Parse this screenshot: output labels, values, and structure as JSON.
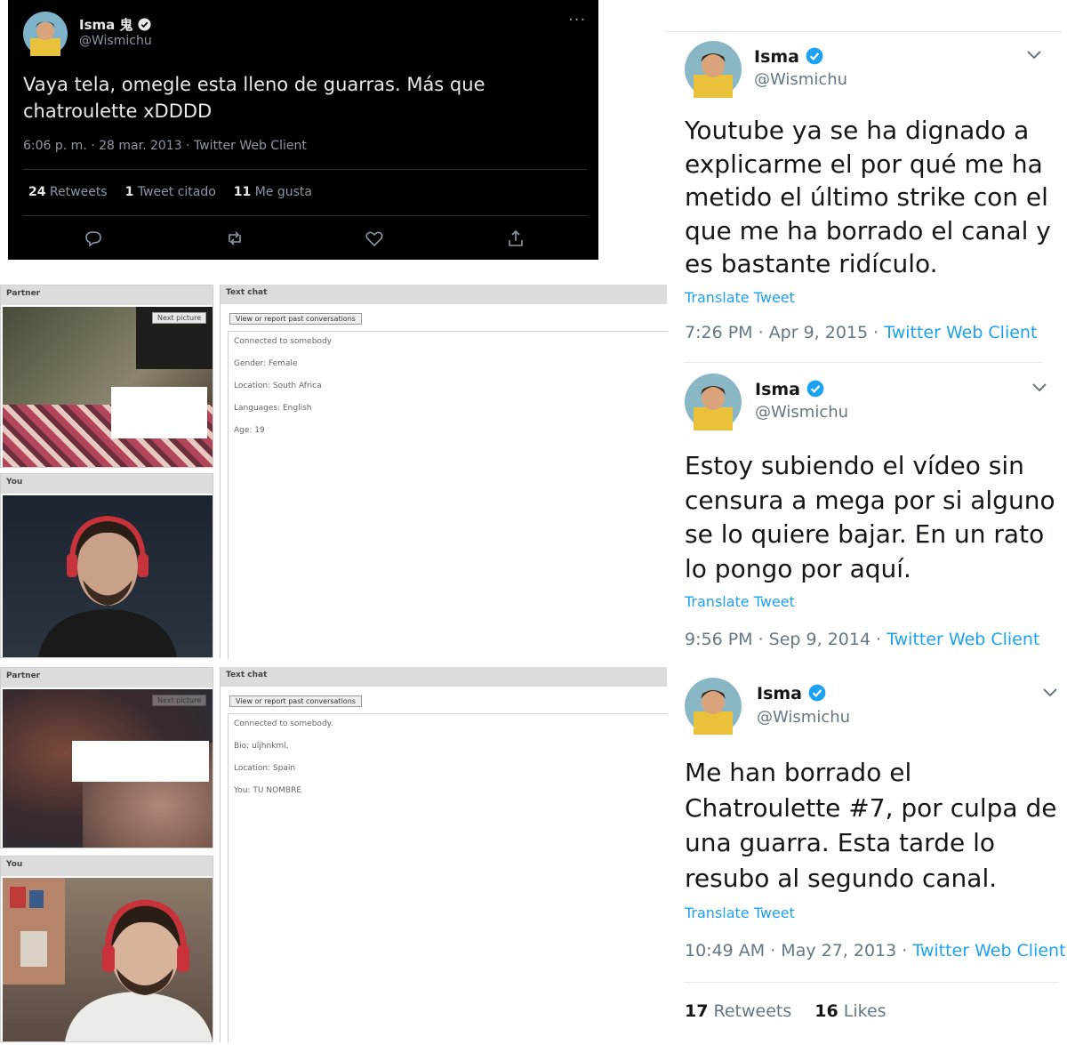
{
  "dark_tweet": {
    "name": "Isma 鬼",
    "handle": "@Wismichu",
    "more": "···",
    "text": "Vaya tela, omegle esta lleno de guarras. Más que chatroulette xDDDD",
    "meta": "6:06 p. m. · 28 mar. 2013 · Twitter Web Client",
    "stats": [
      {
        "count": "24",
        "label": "Retweets"
      },
      {
        "count": "1",
        "label": "Tweet citado"
      },
      {
        "count": "11",
        "label": "Me gusta"
      }
    ]
  },
  "chat_top": {
    "partner_label": "Partner",
    "you_label": "You",
    "textchat_label": "Text chat",
    "next_picture": "Next picture",
    "view_button": "View or report past conversations",
    "lines": [
      "Connected to somebody",
      "Gender: Female",
      "Location: South Africa",
      "Languages: English",
      "Age: 19"
    ]
  },
  "chat_bottom": {
    "partner_label": "Partner",
    "you_label": "You",
    "textchat_label": "Text chat",
    "next_picture": "Next picture",
    "view_button": "View or report past conversations",
    "lines": [
      "Connected to somebody.",
      "Bio: uljhnkml,",
      "Location: Spain",
      "You: TU NOMBRE"
    ]
  },
  "tweets": [
    {
      "name": "Isma",
      "handle": "@Wismichu",
      "text": "Youtube ya se ha dignado a explicarme el por qué me ha metido el último strike con el que me ha borrado el canal y es bastante ridículo.",
      "translate": "Translate Tweet",
      "time": "7:26 PM · Apr 9, 2015 · ",
      "client": "Twitter Web Client"
    },
    {
      "name": "Isma",
      "handle": "@Wismichu",
      "text": "Estoy subiendo el vídeo sin censura a mega por si alguno se lo quiere bajar. En un rato lo pongo por aquí.",
      "translate": "Translate Tweet",
      "time": "9:56 PM · Sep 9, 2014 · ",
      "client": "Twitter Web Client"
    },
    {
      "name": "Isma",
      "handle": "@Wismichu",
      "text": "Me han borrado el Chatroulette #7, por culpa de una guarra. Esta tarde lo resubo al segundo canal.",
      "translate": "Translate Tweet",
      "time": "10:49 AM · May 27, 2013 · ",
      "client": "Twitter Web Client",
      "stats": [
        {
          "count": "17",
          "label": "Retweets"
        },
        {
          "count": "16",
          "label": "Likes"
        }
      ]
    }
  ],
  "colors": {
    "link": "#1da1f2",
    "verified": "#1da1f2",
    "dark_bg": "#000000"
  },
  "icons": [
    "reply-icon",
    "retweet-icon",
    "like-icon",
    "share-icon",
    "verified-badge-icon",
    "chevron-down-icon",
    "more-icon"
  ]
}
